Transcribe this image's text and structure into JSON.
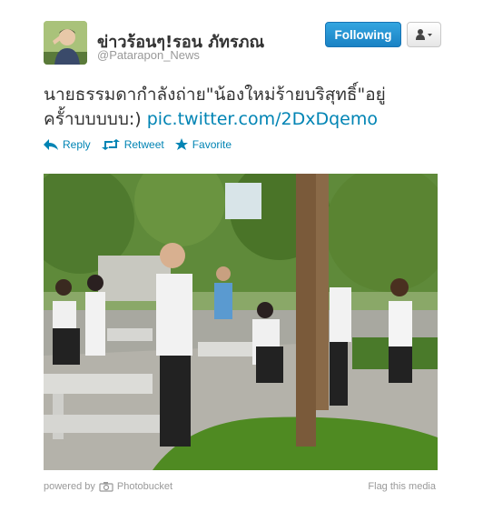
{
  "user": {
    "display_name": "ข่าวร้อนๆ!รอน ภัทรภณ",
    "screen_name": "@Patarapon_News",
    "avatar_icon": "profile-photo"
  },
  "header": {
    "follow_label": "Following",
    "user_menu_icon": "person-dropdown-icon"
  },
  "tweet": {
    "text": "นายธรรมดากำลังถ่าย\"น้องใหม่ร้ายบริสุทธิ์\"อยู่ครั้าบบบบบ:)",
    "link": "pic.twitter.com/2DxDqemo"
  },
  "actions": {
    "reply": "Reply",
    "retweet": "Retweet",
    "favorite": "Favorite"
  },
  "media": {
    "powered_by": "powered by",
    "provider": "Photobucket",
    "flag": "Flag this media"
  },
  "colors": {
    "link": "#0084b4",
    "follow_bg": "#2a9ad8"
  }
}
